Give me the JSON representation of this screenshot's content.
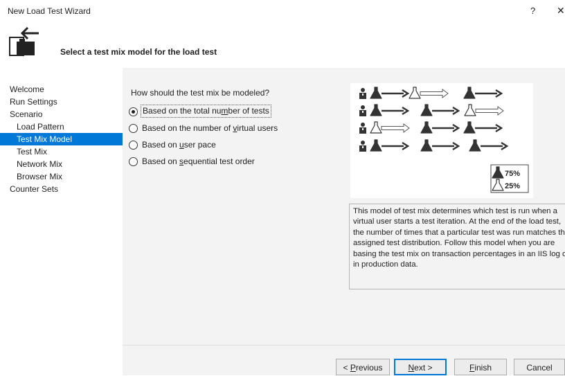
{
  "window": {
    "title": "New Load Test Wizard",
    "help_label": "?",
    "close_label": "✕"
  },
  "header": {
    "title": "Select a test mix model for the load test",
    "icon": "wizard-flask-icon"
  },
  "nav": {
    "items": [
      {
        "label": "Welcome",
        "indent": 0,
        "selected": false
      },
      {
        "label": "Run Settings",
        "indent": 0,
        "selected": false
      },
      {
        "label": "Scenario",
        "indent": 0,
        "selected": false
      },
      {
        "label": "Load Pattern",
        "indent": 1,
        "selected": false
      },
      {
        "label": "Test Mix Model",
        "indent": 1,
        "selected": true
      },
      {
        "label": "Test Mix",
        "indent": 1,
        "selected": false
      },
      {
        "label": "Network Mix",
        "indent": 1,
        "selected": false
      },
      {
        "label": "Browser Mix",
        "indent": 1,
        "selected": false
      },
      {
        "label": "Counter Sets",
        "indent": 0,
        "selected": false
      }
    ]
  },
  "main": {
    "question": "How should the test mix be modeled?",
    "options": [
      {
        "pre": "Based on the total nu",
        "key": "m",
        "post": "ber of tests",
        "checked": true
      },
      {
        "pre": "Based on the number of ",
        "key": "v",
        "post": "irtual users",
        "checked": false
      },
      {
        "pre": "Based on ",
        "key": "u",
        "post": "ser pace",
        "checked": false
      },
      {
        "pre": "Based on ",
        "key": "s",
        "post": "equential test order",
        "checked": false
      }
    ],
    "diagram": {
      "legend": [
        {
          "icon": "filled-flask-icon",
          "value": "75%"
        },
        {
          "icon": "outline-flask-icon",
          "value": "25%"
        }
      ],
      "accent_color": "#3a3a3a"
    },
    "description": "This model of test mix determines which test is run when a\nvirtual user starts a test iteration. At the end of the load test,\nthe number of times that a particular test was run matches the\nassigned test distribution. Follow this model when you are\nbasing the test mix on transaction percentages in an IIS log or\nin production data."
  },
  "buttons": {
    "previous": {
      "pre": "< ",
      "key": "P",
      "post": "revious"
    },
    "next": {
      "pre": "",
      "key": "N",
      "post": "ext >"
    },
    "finish": {
      "pre": "",
      "key": "F",
      "post": "inish"
    },
    "cancel": {
      "pre": "",
      "key": "",
      "post": "Cancel"
    }
  },
  "colors": {
    "selection": "#0078d7",
    "panel": "#f3f3f3"
  }
}
